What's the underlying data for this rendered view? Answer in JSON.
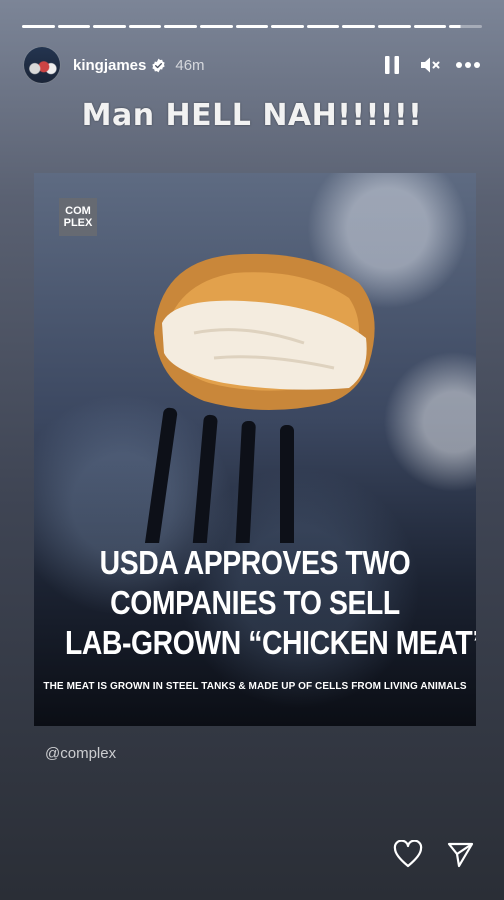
{
  "progress": {
    "segments": 13,
    "current_index": 12,
    "current_fraction": 0.35
  },
  "header": {
    "username": "kingjames",
    "verified": true,
    "time": "46m",
    "icons": {
      "pause": "pause-icon",
      "mute": "mute-icon",
      "more": "more-options-icon"
    }
  },
  "caption": "Man HELL NAH!!!!!!",
  "post": {
    "logo_text": "COM\nPLEX",
    "headline_lines": [
      "USDA APPROVES TWO",
      "COMPANIES TO SELL",
      "LAB-GROWN “CHICKEN MEAT”"
    ],
    "subline": "THE MEAT IS GROWN IN STEEL TANKS & MADE UP OF CELLS FROM LIVING ANIMALS"
  },
  "mention": "@complex",
  "actions": {
    "like": "heart-icon",
    "share": "send-icon"
  },
  "colors": {
    "background_top": "#7c8597",
    "background_bottom": "#2a2e36"
  }
}
